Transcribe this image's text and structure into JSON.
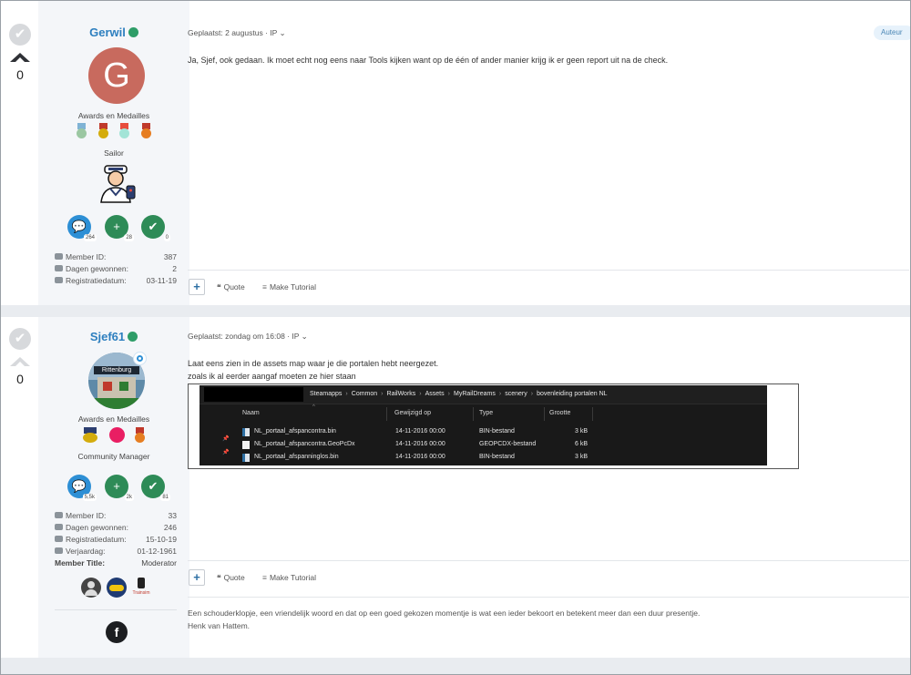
{
  "posts": [
    {
      "vote_count": "0",
      "username": "Gerwil",
      "avatar_letter": "G",
      "awards_label": "Awards en Medailles",
      "rank_title": "Sailor",
      "stats": {
        "posts": "264",
        "reputation": "28",
        "solutions": "0"
      },
      "info": [
        {
          "label": "Member ID:",
          "value": "387"
        },
        {
          "label": "Dagen gewonnen:",
          "value": "2"
        },
        {
          "label": "Registratiedatum:",
          "value": "03-11-19"
        }
      ],
      "posted_meta": "Geplaatst: 2 augustus · IP",
      "author_badge": "Auteur",
      "content": "Ja, Sjef, ook gedaan. Ik moet echt nog eens naar Tools kijken want op de één of ander manier krijg ik er geen report uit na de check.",
      "actions": {
        "quote": "Quote",
        "make_tutorial": "Make Tutorial"
      }
    },
    {
      "vote_count": "0",
      "username": "Sjef61",
      "avatar_text": "Rittenburg",
      "awards_label": "Awards en Medailles",
      "rank_title": "Community Manager",
      "stats": {
        "posts": "5,5k",
        "reputation": "2k",
        "solutions": "81"
      },
      "info": [
        {
          "label": "Member ID:",
          "value": "33"
        },
        {
          "label": "Dagen gewonnen:",
          "value": "246"
        },
        {
          "label": "Registratiedatum:",
          "value": "15-10-19"
        },
        {
          "label": "Verjaardag:",
          "value": "01-12-1961"
        },
        {
          "label": "Member Title:",
          "value": "Moderator"
        }
      ],
      "posted_meta": "Geplaatst: zondag om 16:08 · IP",
      "content_line1": "Laat eens zien in de assets map waar je  die portalen hebt neergezet.",
      "content_line2": "zoals ik al eerder aangaf moeten ze hier staan",
      "explorer": {
        "breadcrumb": [
          "Steamapps",
          "Common",
          "RailWorks",
          "Assets",
          "MyRailDreams",
          "scenery",
          "bovenleiding portalen NL"
        ],
        "headers": {
          "name": "Naam",
          "modified": "Gewijzigd op",
          "type": "Type",
          "size": "Grootte"
        },
        "files": [
          {
            "name": "NL_portaal_afspancontra.bin",
            "modified": "14-11-2016 00:00",
            "type": "BIN-bestand",
            "size": "3 kB"
          },
          {
            "name": "NL_portaal_afspancontra.GeoPcDx",
            "modified": "14-11-2016 00:00",
            "type": "GEOPCDX-bestand",
            "size": "6 kB"
          },
          {
            "name": "NL_portaal_afspanninglos.bin",
            "modified": "14-11-2016 00:00",
            "type": "BIN-bestand",
            "size": "3 kB"
          }
        ]
      },
      "badge_text": "Trainsim",
      "actions": {
        "quote": "Quote",
        "make_tutorial": "Make Tutorial"
      },
      "signature_line1": "Een schouderklopje, een vriendelijk woord en dat op een goed gekozen momentje is wat een ieder bekoort en betekent meer dan een duur presentje.",
      "signature_line2": "Henk van Hattem."
    }
  ],
  "colors": {
    "username": "#2d7fbf",
    "online": "#2e9d68",
    "avatar_g": "#c86a5e",
    "posts_circle": "#2d8fd5",
    "rep_circle": "#2e8b57",
    "solution_circle": "#2e8b57"
  }
}
